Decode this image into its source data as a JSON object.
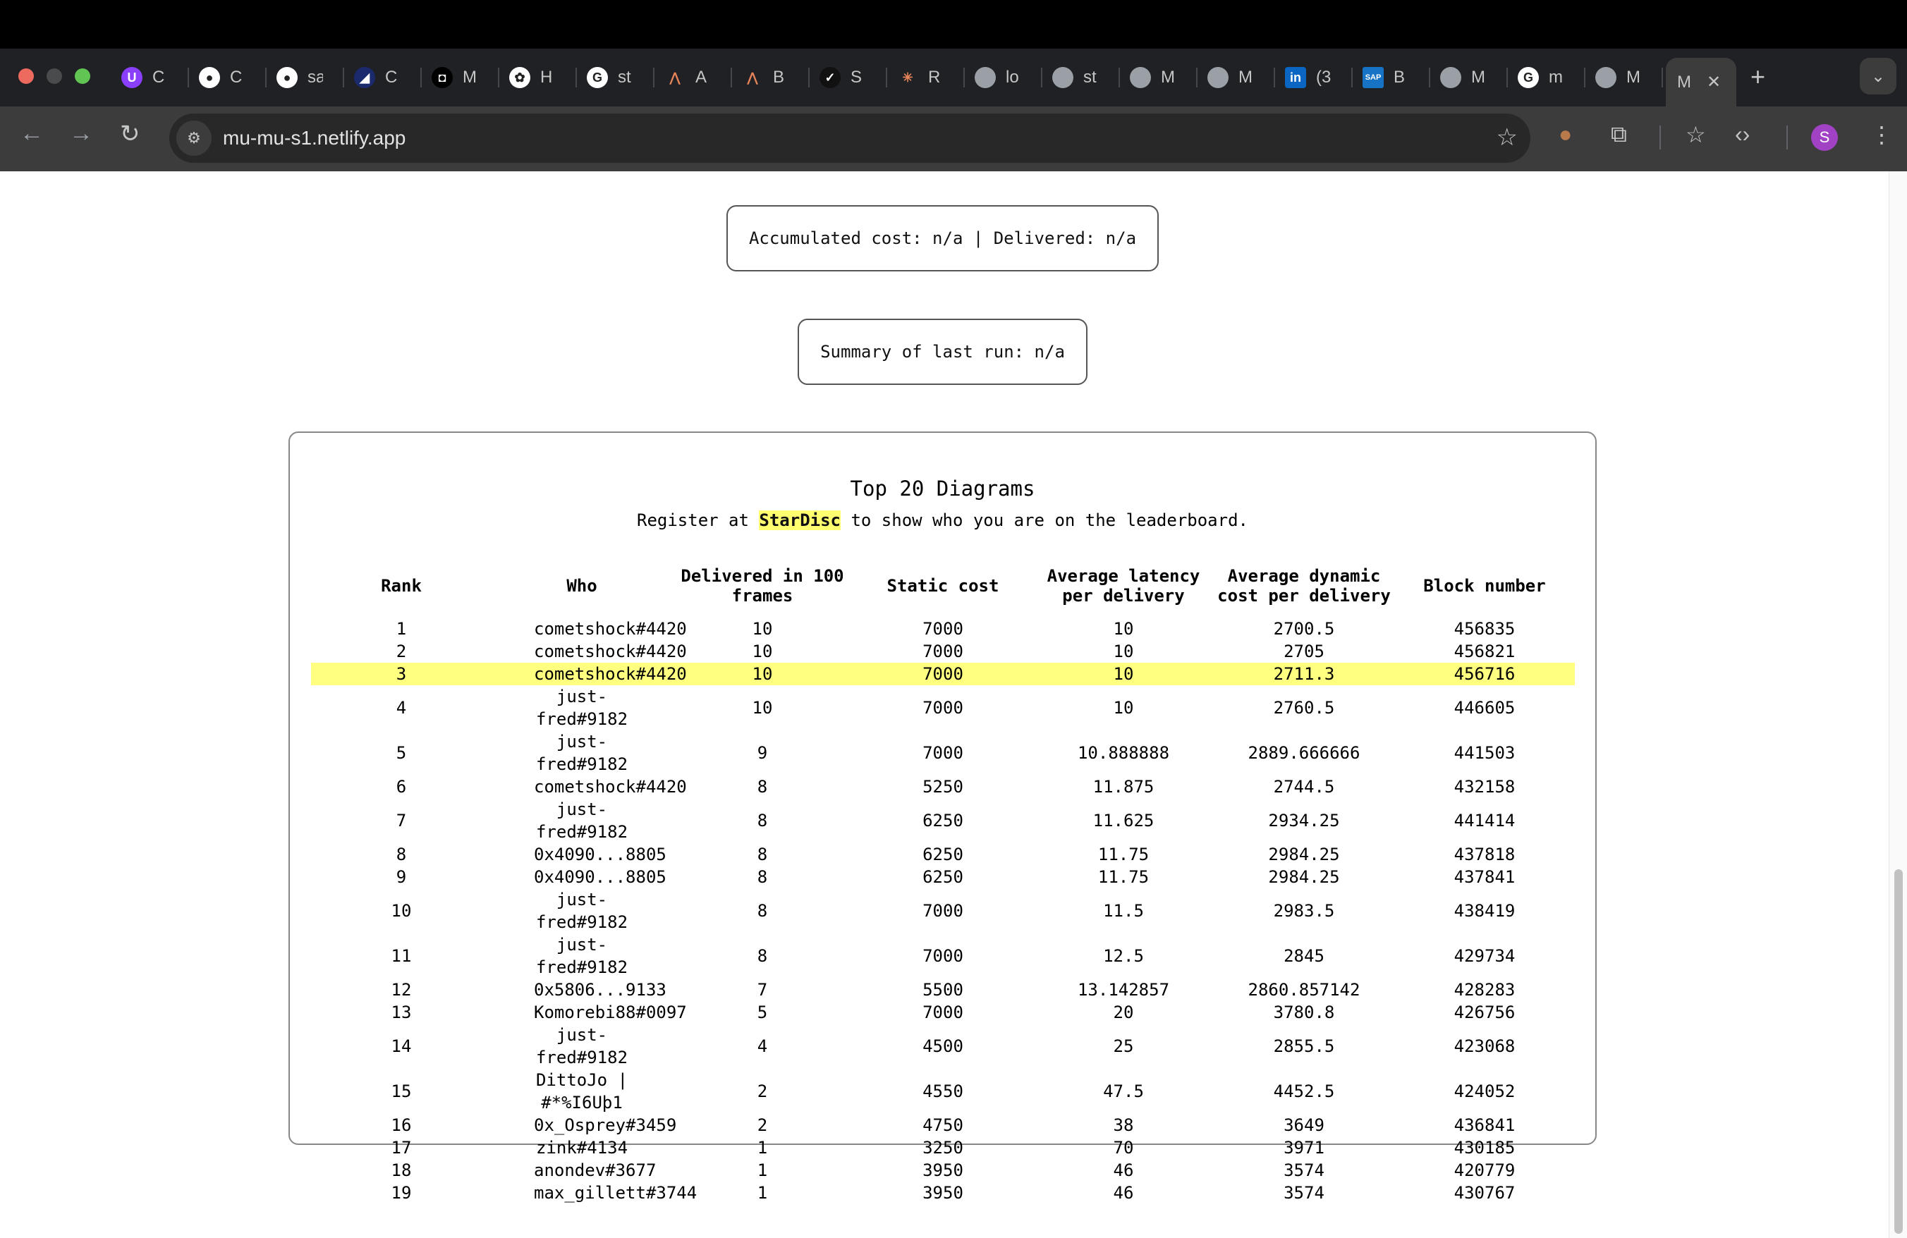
{
  "browser": {
    "tabs": [
      {
        "icon": "proton-icon",
        "letter": "C",
        "bg": "#8a3ffc",
        "glyph": "U"
      },
      {
        "icon": "github-icon",
        "letter": "C",
        "bg": "#ffffff",
        "glyph": "●"
      },
      {
        "icon": "github-icon",
        "letter": "sa",
        "bg": "#ffffff",
        "glyph": "●"
      },
      {
        "icon": "app-icon",
        "letter": "C",
        "bg": "#1a2a6c",
        "glyph": "◢"
      },
      {
        "icon": "app-icon",
        "letter": "M",
        "bg": "#000000",
        "glyph": "◘"
      },
      {
        "icon": "openai-icon",
        "letter": "H",
        "bg": "#ffffff",
        "glyph": "✿"
      },
      {
        "icon": "google-icon",
        "letter": "st",
        "bg": "#ffffff",
        "glyph": "G"
      },
      {
        "icon": "anthropic-icon",
        "letter": "A",
        "bg": "transparent",
        "glyph": "⋀"
      },
      {
        "icon": "anthropic-icon",
        "letter": "B",
        "bg": "transparent",
        "glyph": "⋀"
      },
      {
        "icon": "app-icon",
        "letter": "S",
        "bg": "#111111",
        "glyph": "✓"
      },
      {
        "icon": "claude-icon",
        "letter": "R",
        "bg": "transparent",
        "glyph": "✳"
      },
      {
        "icon": "globe-icon",
        "letter": "lo",
        "bg": "#9aa0a6",
        "glyph": ""
      },
      {
        "icon": "globe-icon",
        "letter": "st",
        "bg": "#9aa0a6",
        "glyph": ""
      },
      {
        "icon": "globe-icon",
        "letter": "M",
        "bg": "#9aa0a6",
        "glyph": ""
      },
      {
        "icon": "globe-icon",
        "letter": "M",
        "bg": "#9aa0a6",
        "glyph": ""
      },
      {
        "icon": "linkedin-icon",
        "letter": "(3",
        "bg": "#0a66c2",
        "glyph": "in"
      },
      {
        "icon": "sap-icon",
        "letter": "B",
        "bg": "#1673c6",
        "glyph": "SAP"
      },
      {
        "icon": "globe-icon",
        "letter": "M",
        "bg": "#9aa0a6",
        "glyph": ""
      },
      {
        "icon": "google-icon",
        "letter": "m",
        "bg": "#ffffff",
        "glyph": "G"
      },
      {
        "icon": "globe-icon",
        "letter": "M",
        "bg": "#9aa0a6",
        "glyph": ""
      }
    ],
    "active_tab": "M",
    "url": "mu-mu-s1.netlify.app",
    "profile_initial": "S"
  },
  "status": {
    "accumulated": "Accumulated cost: n/a | Delivered: n/a",
    "summary": "Summary of last run: n/a"
  },
  "leaderboard": {
    "title": "Top 20 Diagrams",
    "sub_before": "Register at",
    "sub_link": "StarDisc",
    "sub_after": "to show who you are on the leaderboard.",
    "headers": [
      "Rank",
      "Who",
      "Delivered in 100 frames",
      "Static cost",
      "Average latency per delivery",
      "Average dynamic cost per delivery",
      "Block number"
    ],
    "highlight_rank": 3,
    "rows": [
      [
        "1",
        "cometshock#4420",
        "10",
        "7000",
        "10",
        "2700.5",
        "456835"
      ],
      [
        "2",
        "cometshock#4420",
        "10",
        "7000",
        "10",
        "2705",
        "456821"
      ],
      [
        "3",
        "cometshock#4420",
        "10",
        "7000",
        "10",
        "2711.3",
        "456716"
      ],
      [
        "4",
        "just-fred#9182",
        "10",
        "7000",
        "10",
        "2760.5",
        "446605"
      ],
      [
        "5",
        "just-fred#9182",
        "9",
        "7000",
        "10.888888",
        "2889.666666",
        "441503"
      ],
      [
        "6",
        "cometshock#4420",
        "8",
        "5250",
        "11.875",
        "2744.5",
        "432158"
      ],
      [
        "7",
        "just-fred#9182",
        "8",
        "6250",
        "11.625",
        "2934.25",
        "441414"
      ],
      [
        "8",
        "0x4090...8805",
        "8",
        "6250",
        "11.75",
        "2984.25",
        "437818"
      ],
      [
        "9",
        "0x4090...8805",
        "8",
        "6250",
        "11.75",
        "2984.25",
        "437841"
      ],
      [
        "10",
        "just-fred#9182",
        "8",
        "7000",
        "11.5",
        "2983.5",
        "438419"
      ],
      [
        "11",
        "just-fred#9182",
        "8",
        "7000",
        "12.5",
        "2845",
        "429734"
      ],
      [
        "12",
        "0x5806...9133",
        "7",
        "5500",
        "13.142857",
        "2860.857142",
        "428283"
      ],
      [
        "13",
        "Komorebi88#0097",
        "5",
        "7000",
        "20",
        "3780.8",
        "426756"
      ],
      [
        "14",
        "just-fred#9182",
        "4",
        "4500",
        "25",
        "2855.5",
        "423068"
      ],
      [
        "15",
        "DittoJo | #*%I6Uþ1",
        "2",
        "4550",
        "47.5",
        "4452.5",
        "424052"
      ],
      [
        "16",
        "0x_Osprey#3459",
        "2",
        "4750",
        "38",
        "3649",
        "436841"
      ],
      [
        "17",
        "zink#4134",
        "1",
        "3250",
        "70",
        "3971",
        "430185"
      ],
      [
        "18",
        "anondev#3677",
        "1",
        "3950",
        "46",
        "3574",
        "420779"
      ],
      [
        "19",
        "max_gillett#3744",
        "1",
        "3950",
        "46",
        "3574",
        "430767"
      ]
    ]
  }
}
